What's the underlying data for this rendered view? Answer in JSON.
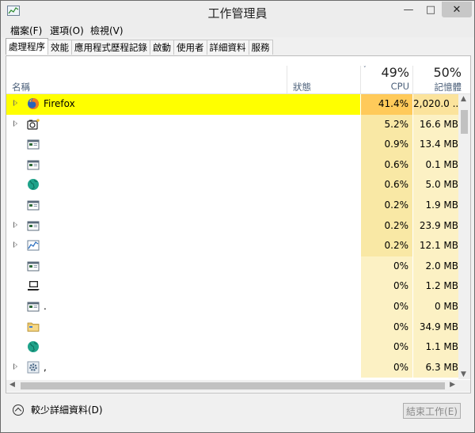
{
  "window": {
    "title": "工作管理員",
    "min_glyph": "—",
    "max_glyph": "□",
    "close_glyph": "✕"
  },
  "menu": [
    "檔案(F)",
    "選項(O)",
    "檢視(V)"
  ],
  "tabs": [
    "處理程序",
    "效能",
    "應用程式歷程記錄",
    "啟動",
    "使用者",
    "詳細資料",
    "服務"
  ],
  "active_tab": "處理程序",
  "header": {
    "name": "名稱",
    "status": "狀態",
    "cpu_percent": "49%",
    "cpu_label": "CPU",
    "mem_percent": "50%",
    "mem_label": "記憶體",
    "sort_glyph": "˅"
  },
  "processes": [
    {
      "name": "Firefox",
      "cpu": "41.4%",
      "mem": "2,020.0 ...",
      "expandable": true,
      "selected": true,
      "icon": "firefox-icon"
    },
    {
      "name": "",
      "cpu": "5.2%",
      "mem": "16.6 MB",
      "expandable": true,
      "icon": "camera-app-icon"
    },
    {
      "name": "",
      "cpu": "0.9%",
      "mem": "13.4 MB",
      "expandable": false,
      "icon": "window-app-icon"
    },
    {
      "name": "",
      "cpu": "0.6%",
      "mem": "0.1 MB",
      "expandable": false,
      "icon": "window-app-icon"
    },
    {
      "name": "",
      "cpu": "0.6%",
      "mem": "5.0 MB",
      "expandable": false,
      "icon": "globe-app-icon"
    },
    {
      "name": "",
      "cpu": "0.2%",
      "mem": "1.9 MB",
      "expandable": false,
      "icon": "window-app-icon"
    },
    {
      "name": "",
      "cpu": "0.2%",
      "mem": "23.9 MB",
      "expandable": true,
      "icon": "window-app-icon"
    },
    {
      "name": "",
      "cpu": "0.2%",
      "mem": "12.1 MB",
      "expandable": true,
      "icon": "chart-app-icon"
    },
    {
      "name": "",
      "cpu": "0%",
      "mem": "2.0 MB",
      "expandable": false,
      "icon": "window-app-icon"
    },
    {
      "name": "",
      "cpu": "0%",
      "mem": "1.2 MB",
      "expandable": false,
      "icon": "laptop-app-icon"
    },
    {
      "name": ".",
      "cpu": "0%",
      "mem": "0 MB",
      "expandable": false,
      "icon": "window-app-icon"
    },
    {
      "name": "",
      "cpu": "0%",
      "mem": "34.9 MB",
      "expandable": false,
      "icon": "folder-app-icon"
    },
    {
      "name": "",
      "cpu": "0%",
      "mem": "1.1 MB",
      "expandable": false,
      "icon": "globe-app-icon"
    },
    {
      "name": ",",
      "cpu": "0%",
      "mem": "6.3 MB",
      "expandable": true,
      "icon": "gear-app-icon"
    }
  ],
  "footer": {
    "fewer_details": "較少詳細資料(D)",
    "end_task": "結束工作(E)"
  },
  "colors": {
    "selected_row": "#ffff00",
    "cpu_heat_high": "#ffca5a",
    "cpu_heat_mid": "#f9e8a5",
    "cpu_heat_low": "#fcf1c4"
  }
}
